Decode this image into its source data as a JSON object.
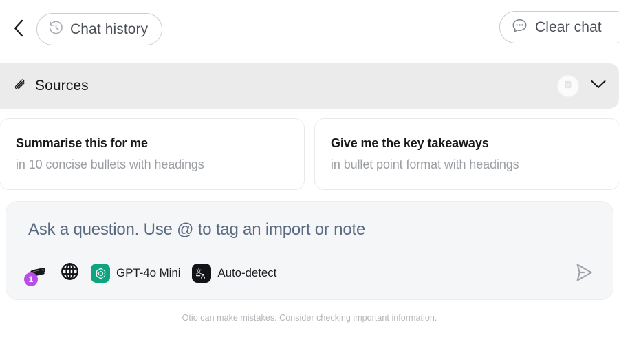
{
  "header": {
    "back_icon": "chevron-left-icon",
    "chat_history": {
      "label": "Chat history",
      "icon": "history-clock-icon"
    },
    "clear_chat": {
      "label": "Clear chat",
      "icon": "chat-bubble-dots-icon"
    }
  },
  "sources": {
    "title": "Sources",
    "icon": "paperclip-icon",
    "expand_icon": "chevron-down-icon",
    "chip_icon": "document-icon"
  },
  "suggestions": [
    {
      "title": "Summarise this for me",
      "subtitle": "in 10 concise bullets with headings"
    },
    {
      "title": "Give me the key takeaways",
      "subtitle": "in bullet point format with headings"
    }
  ],
  "composer": {
    "placeholder": "Ask a question. Use @ to tag an import or note",
    "value": "",
    "attachment_count": "1",
    "attach_icon": "paperclip-icon",
    "web_icon": "globe-icon",
    "model": {
      "label": "GPT-4o Mini",
      "icon": "openai-logo-icon",
      "color": "#10a37f"
    },
    "language": {
      "label": "Auto-detect",
      "icon": "translate-icon",
      "color": "#111317"
    },
    "send_icon": "send-paper-plane-icon",
    "badge_color": "#b84ee8"
  },
  "footer": {
    "disclaimer": "Otio can make mistakes. Consider checking important information."
  }
}
